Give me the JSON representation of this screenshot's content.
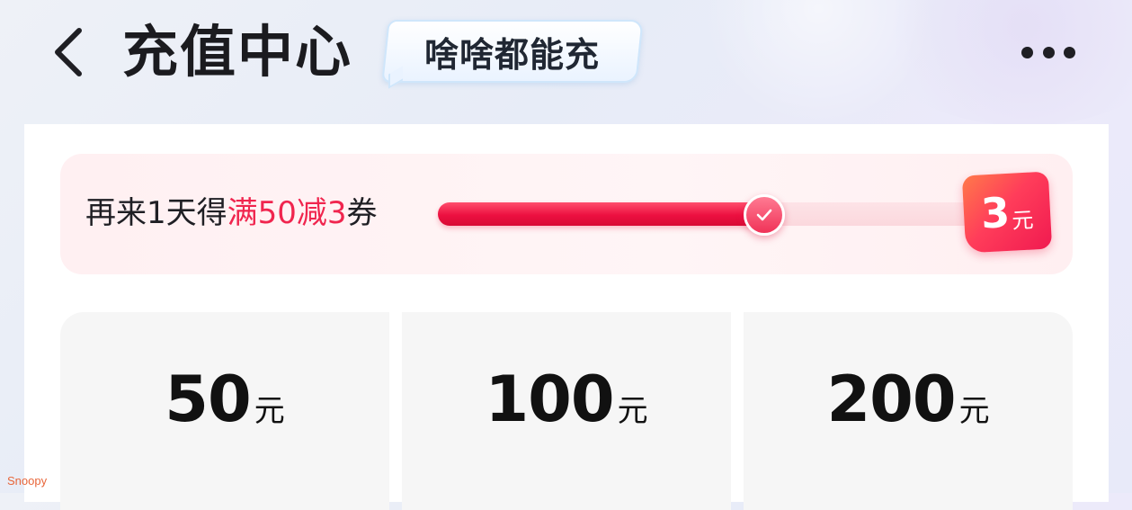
{
  "header": {
    "back_icon": "chevron-left-icon",
    "title": "充值中心",
    "slogan": "啥啥都能充",
    "more_icon": "more-horizontal-icon"
  },
  "progress": {
    "text_prefix": "再来1天得",
    "text_highlight": "满50减3",
    "text_suffix": "券",
    "percent": 58,
    "knob_icon": "check-icon",
    "reward_value": "3",
    "reward_unit": "元"
  },
  "amounts": [
    {
      "value": "50",
      "unit": "元"
    },
    {
      "value": "100",
      "unit": "元"
    },
    {
      "value": "200",
      "unit": "元"
    }
  ],
  "watermark": "Snoopy",
  "colors": {
    "accent": "#f0254e",
    "title": "#1b1b1f",
    "card_bg": "#f6f6f6"
  }
}
